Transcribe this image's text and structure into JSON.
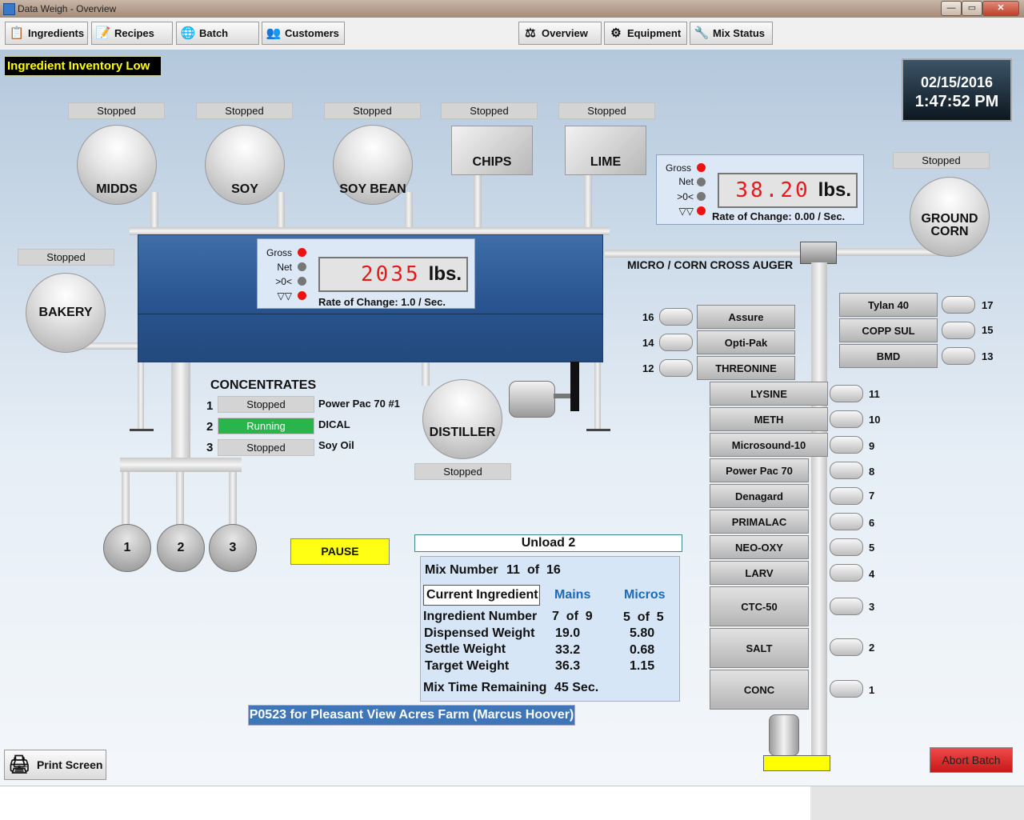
{
  "window": {
    "title": "Data Weigh - Overview",
    "min": "—",
    "max": "▭",
    "close": "✕"
  },
  "toolbar": {
    "ingredients": "Ingredients",
    "recipes": "Recipes",
    "batch": "Batch",
    "customers": "Customers",
    "overview": "Overview",
    "equipment": "Equipment",
    "mix_status": "Mix Status"
  },
  "alert": "Ingredient Inventory Low",
  "datetime": {
    "date": "02/15/2016",
    "time": "1:47:52 PM"
  },
  "bins": {
    "midds": {
      "label": "MIDDS",
      "status": "Stopped"
    },
    "soy": {
      "label": "SOY",
      "status": "Stopped"
    },
    "soy_bean": {
      "label": "SOY BEAN",
      "status": "Stopped"
    },
    "chips": {
      "label": "CHIPS",
      "status": "Stopped"
    },
    "lime": {
      "label": "LIME",
      "status": "Stopped"
    },
    "ground_corn": {
      "label": "GROUND CORN",
      "status": "Stopped"
    },
    "bakery": {
      "label": "BAKERY",
      "status": "Stopped"
    },
    "distiller": {
      "label": "DISTILLER",
      "status": "Stopped"
    }
  },
  "main_scale": {
    "gross": "Gross",
    "net": "Net",
    "zero": ">0<",
    "motion": "▽▽",
    "value": "2035",
    "unit": "lbs.",
    "rate": "Rate of Change: 1.0 / Sec."
  },
  "micro_scale": {
    "gross": "Gross",
    "net": "Net",
    "zero": ">0<",
    "motion": "▽▽",
    "value": "38.20",
    "unit": "lbs.",
    "rate": "Rate of Change: 0.00 / Sec."
  },
  "cross_auger": "MICRO / CORN CROSS AUGER",
  "concentrates": {
    "title": "CONCENTRATES",
    "items": [
      {
        "num": "1",
        "status": "Stopped",
        "name": "Power Pac 70 #1"
      },
      {
        "num": "2",
        "status": "Running",
        "name": "DICAL"
      },
      {
        "num": "3",
        "status": "Stopped",
        "name": "Soy Oil"
      }
    ]
  },
  "hoppers": [
    "1",
    "2",
    "3"
  ],
  "pause": "PAUSE",
  "unload": "Unload 2",
  "mix": {
    "mix_number_label": "Mix Number",
    "mix_number": "11",
    "of": "of",
    "mix_total": "16",
    "current_ingredient": "Current Ingredient",
    "mains": "Mains",
    "micros": "Micros",
    "rows": [
      {
        "label": "Ingredient Number",
        "mains": "7  of  9",
        "micros": "5  of  5"
      },
      {
        "label": "Dispensed Weight",
        "mains": "19.0",
        "micros": "5.80"
      },
      {
        "label": "Settle Weight",
        "mains": "33.2",
        "micros": "0.68"
      },
      {
        "label": "Target Weight",
        "mains": "36.3",
        "micros": "1.15"
      }
    ],
    "time_label": "Mix Time Remaining",
    "time_value": "45 Sec."
  },
  "order": "P0523 for Pleasant View Acres Farm (Marcus Hoover)",
  "micros": {
    "left": [
      {
        "num": "16",
        "name": "Assure"
      },
      {
        "num": "14",
        "name": "Opti-Pak"
      },
      {
        "num": "12",
        "name": "THREONINE"
      }
    ],
    "right": [
      {
        "num": "17",
        "name": "Tylan 40"
      },
      {
        "num": "15",
        "name": "COPP SUL"
      },
      {
        "num": "13",
        "name": "BMD"
      }
    ],
    "column": [
      {
        "num": "11",
        "name": "LYSINE"
      },
      {
        "num": "10",
        "name": "METH"
      },
      {
        "num": "9",
        "name": "Microsound-10"
      },
      {
        "num": "8",
        "name": "Power Pac 70"
      },
      {
        "num": "7",
        "name": "Denagard"
      },
      {
        "num": "6",
        "name": "PRIMALAC"
      },
      {
        "num": "5",
        "name": "NEO-OXY"
      },
      {
        "num": "4",
        "name": "LARV"
      },
      {
        "num": "3",
        "name": "CTC-50"
      },
      {
        "num": "2",
        "name": "SALT"
      },
      {
        "num": "1",
        "name": "CONC"
      }
    ]
  },
  "print_screen": "Print Screen",
  "abort": "Abort Batch",
  "colors": {
    "alert_bg": "#000000",
    "alert_text": "#ffff00",
    "running": "#29b54b",
    "abort": "#e02020",
    "pause": "#ffff00",
    "readout_digits": "#e51a1a"
  },
  "icons": [
    "app-icon",
    "ingredients-icon",
    "recipes-icon",
    "batch-icon",
    "customers-icon",
    "overview-icon",
    "equipment-icon",
    "mix-status-icon",
    "printer-icon"
  ]
}
